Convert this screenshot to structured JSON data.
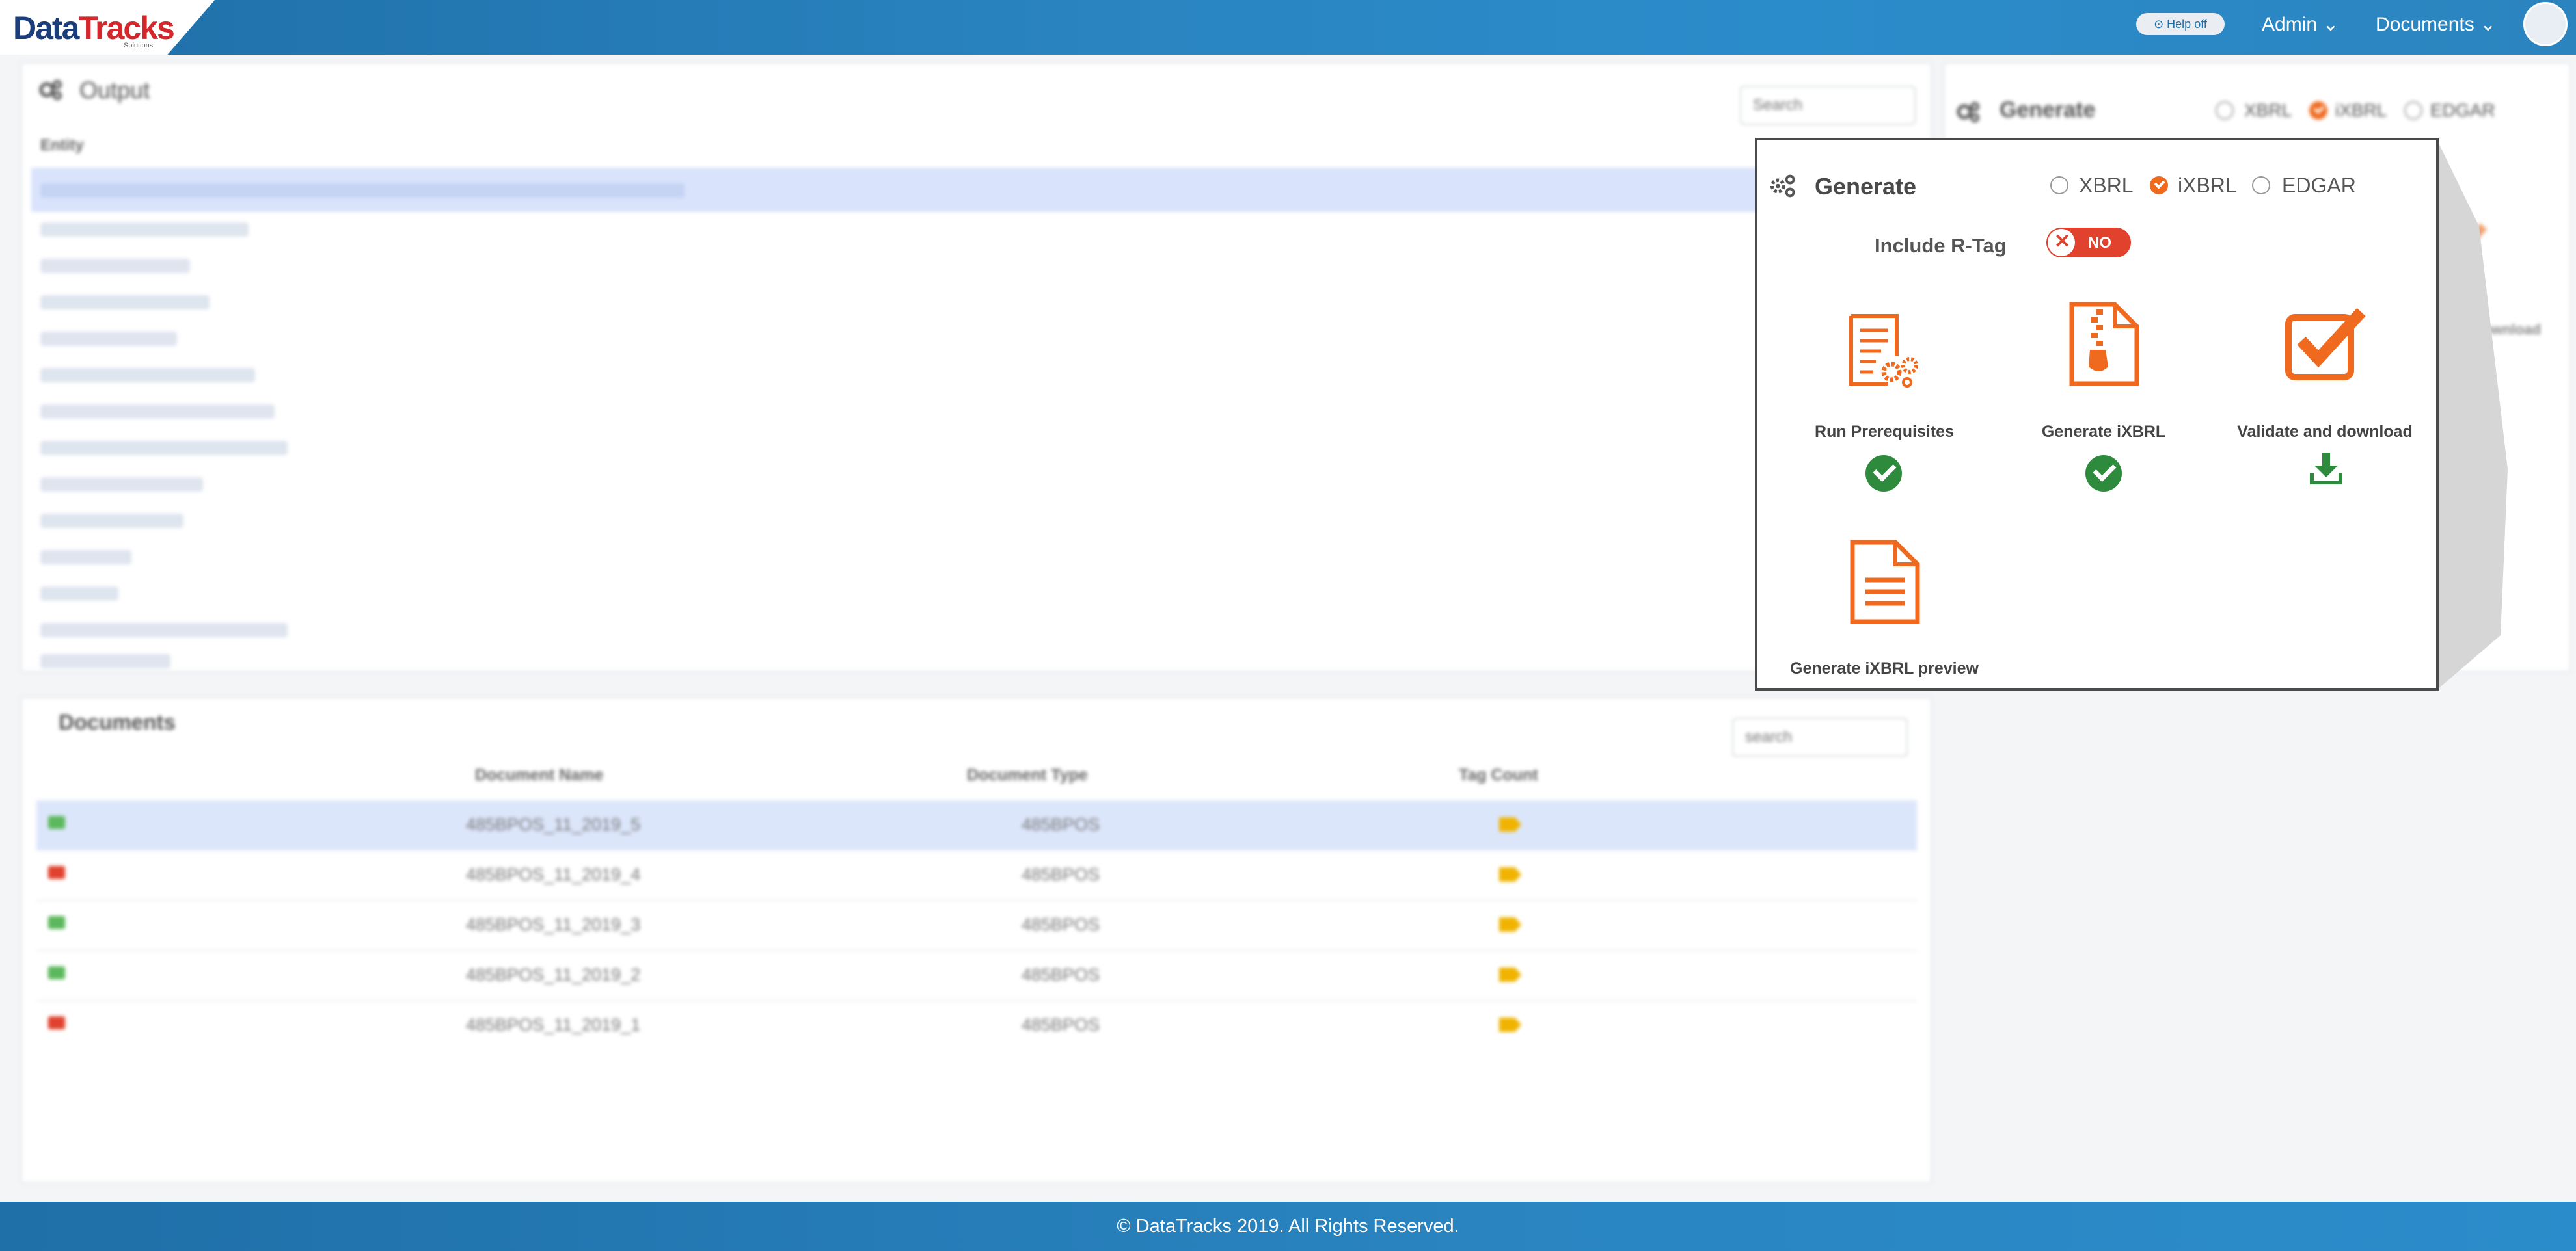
{
  "header": {
    "logo_main": "Data",
    "logo_accent": "Tracks",
    "logo_sub": "Solutions",
    "help_label": "⊙ Help off",
    "admin_label": "Admin ⌄",
    "documents_label": "Documents ⌄"
  },
  "output_panel": {
    "title": "Output",
    "search_placeholder": "Search",
    "column_entity": "Entity"
  },
  "generate_panel_bg": {
    "title": "Generate",
    "options": [
      "XBRL",
      "iXBRL",
      "EDGAR"
    ],
    "validate_label_partial": "and download"
  },
  "documents": {
    "title": "Documents",
    "search_placeholder": "search",
    "columns": [
      "Document Name",
      "Document Type",
      "Tag Count"
    ],
    "rows": [
      {
        "name": "485BPOS_11_2019_5",
        "type": "485BPOS",
        "folder_color": "#5cb85c"
      },
      {
        "name": "485BPOS_11_2019_4",
        "type": "485BPOS",
        "folder_color": "#e0422d"
      },
      {
        "name": "485BPOS_11_2019_3",
        "type": "485BPOS",
        "folder_color": "#5cb85c"
      },
      {
        "name": "485BPOS_11_2019_2",
        "type": "485BPOS",
        "folder_color": "#5cb85c"
      },
      {
        "name": "485BPOS_11_2019_1",
        "type": "485BPOS",
        "folder_color": "#e0422d"
      }
    ]
  },
  "modal": {
    "title": "Generate",
    "options": [
      {
        "label": "XBRL",
        "selected": false
      },
      {
        "label": "iXBRL",
        "selected": true
      },
      {
        "label": "EDGAR",
        "selected": false
      }
    ],
    "rtag_label": "Include R-Tag",
    "rtag_toggle": "NO",
    "actions": [
      {
        "label": "Run Prerequisites",
        "status": "done",
        "icon": "report-gear-icon"
      },
      {
        "label": "Generate iXBRL",
        "status": "done",
        "icon": "zip-file-icon"
      },
      {
        "label": "Validate and download",
        "status": "download",
        "icon": "checkbox-icon"
      },
      {
        "label": "Generate iXBRL preview",
        "status": "",
        "icon": "document-icon"
      }
    ]
  },
  "footer": {
    "text": "© DataTracks 2019. All Rights Reserved."
  },
  "colors": {
    "header_blue": "#2a85c1",
    "accent_orange": "#ef6a1e",
    "success_green": "#2e8b3e",
    "toggle_red": "#e0422d"
  }
}
